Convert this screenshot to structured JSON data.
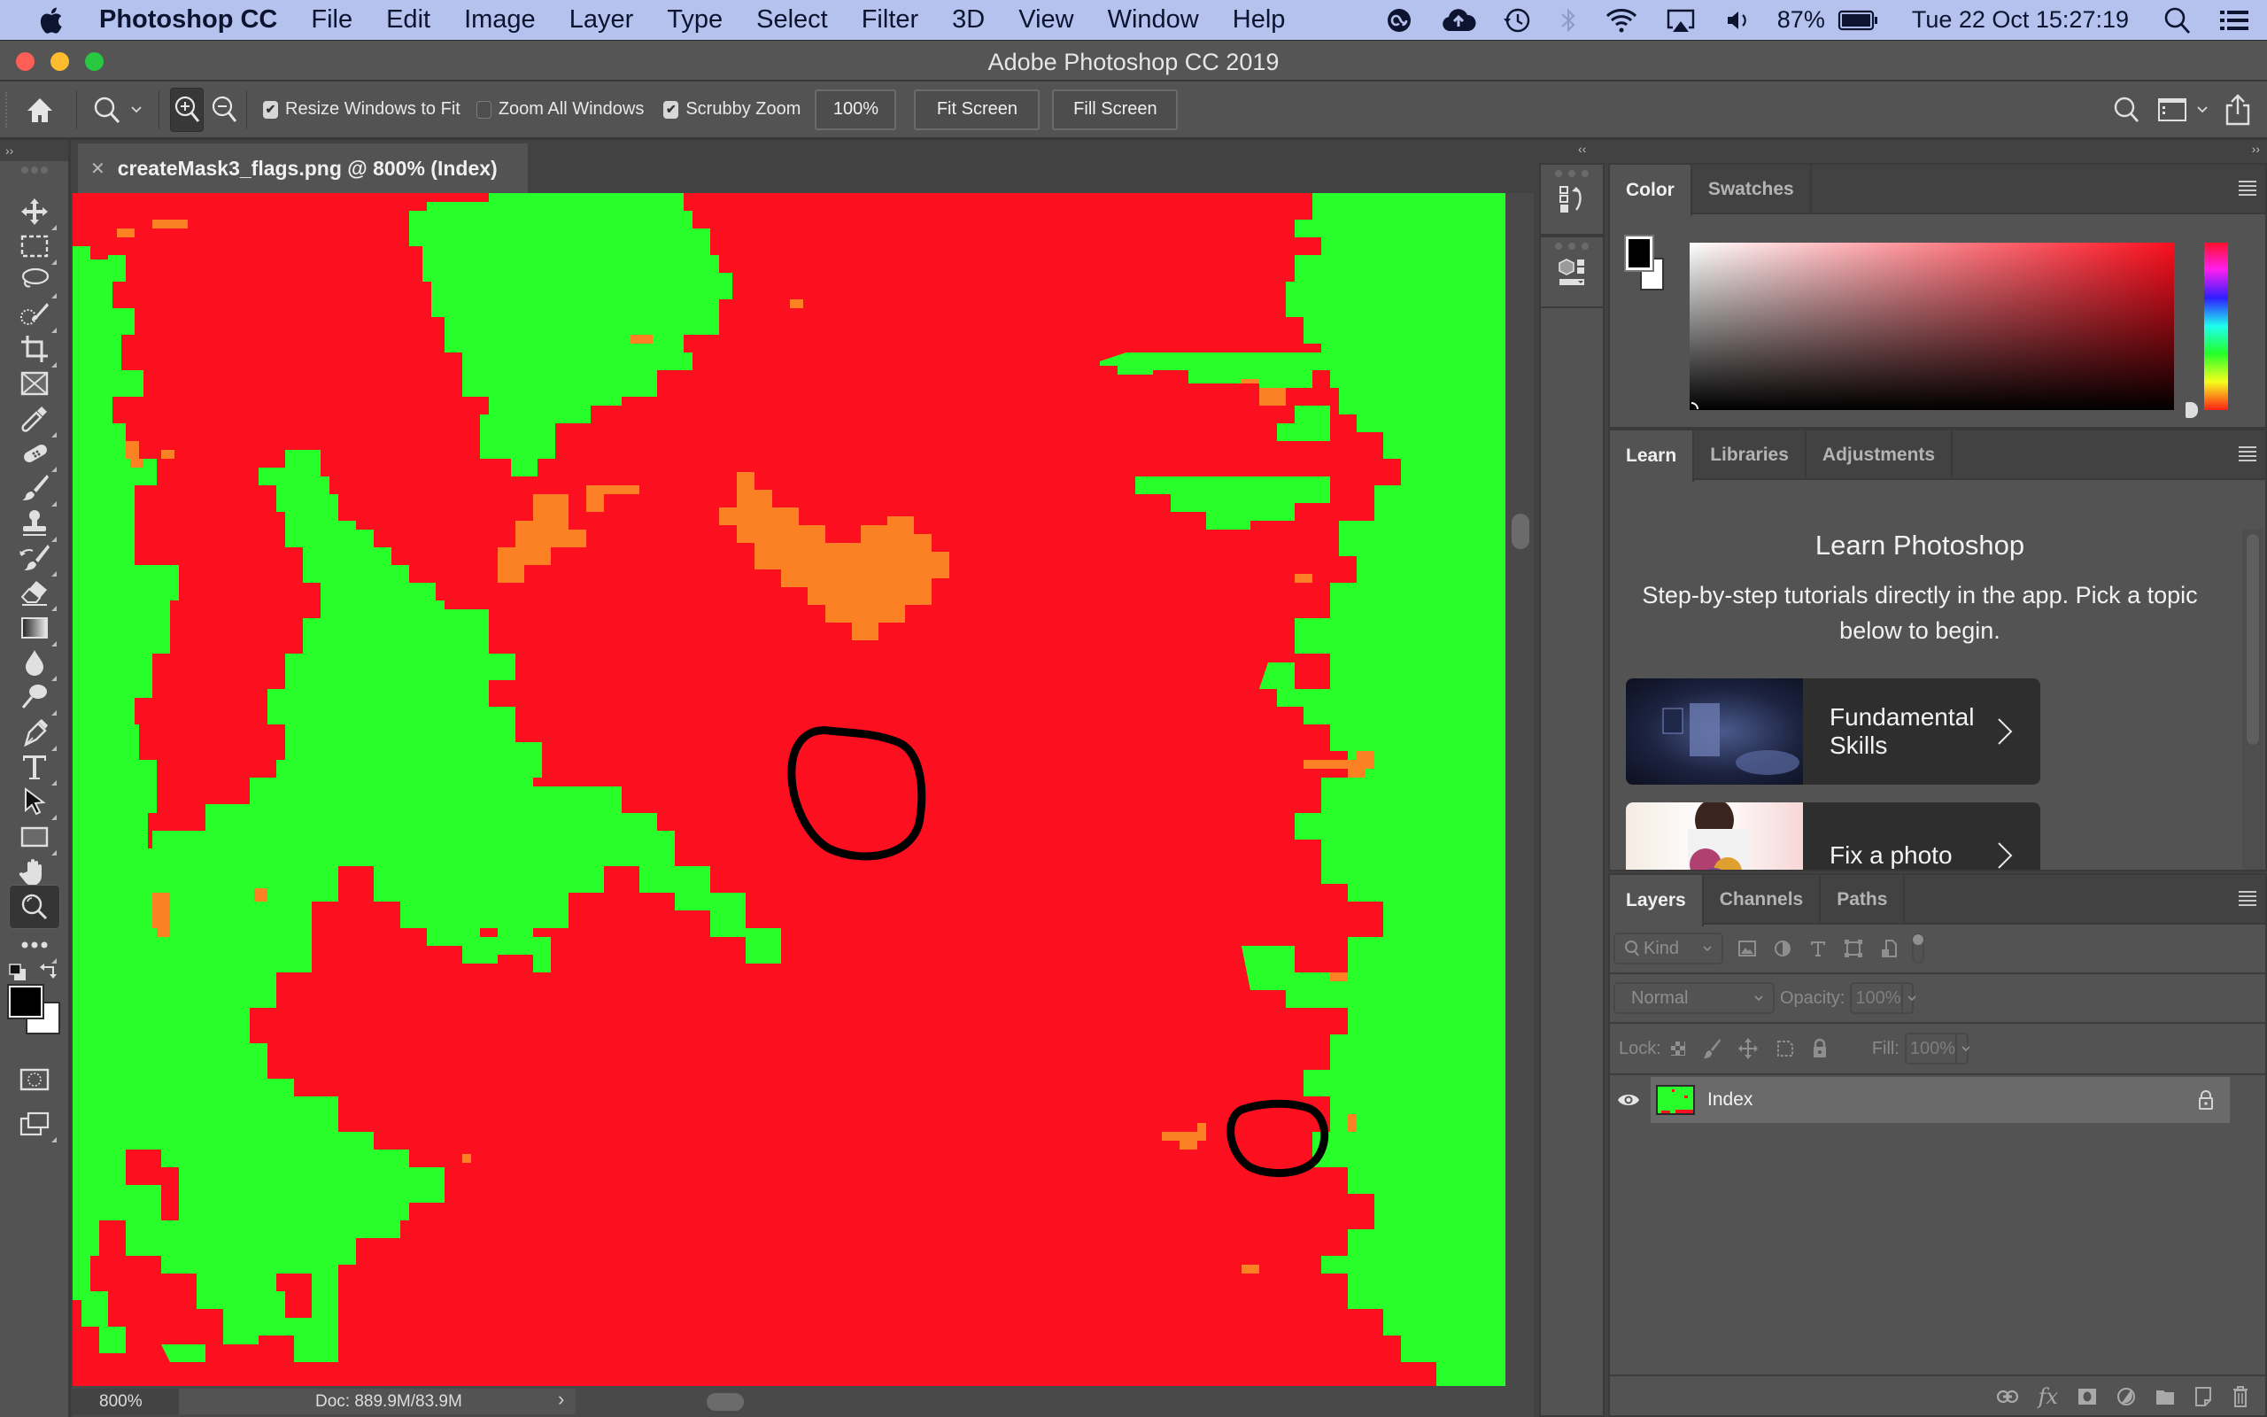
{
  "menubar": {
    "app_name": "Photoshop CC",
    "items": [
      "File",
      "Edit",
      "Image",
      "Layer",
      "Type",
      "Select",
      "Filter",
      "3D",
      "View",
      "Window",
      "Help"
    ],
    "status_icons": [
      "creative-cloud-icon",
      "cloud-upload-icon",
      "time-machine-icon",
      "bluetooth-icon",
      "wifi-icon",
      "airplay-icon",
      "volume-icon"
    ],
    "battery_percent": "87%",
    "datetime": "Tue 22 Oct  15:27:19"
  },
  "window": {
    "title": "Adobe Photoshop CC 2019"
  },
  "options_bar": {
    "resize_windows_label": "Resize Windows to Fit",
    "resize_windows_checked": true,
    "zoom_all_label": "Zoom All Windows",
    "zoom_all_checked": false,
    "scrubby_zoom_label": "Scrubby Zoom",
    "scrubby_zoom_checked": true,
    "zoom_100_label": "100%",
    "fit_screen_label": "Fit Screen",
    "fill_screen_label": "Fill Screen",
    "zoom_mode": "zoom-in"
  },
  "tools": [
    "move-tool",
    "marquee-tool",
    "lasso-tool",
    "quick-selection-tool",
    "crop-tool",
    "frame-tool",
    "eyedropper-tool",
    "healing-brush-tool",
    "brush-tool",
    "clone-stamp-tool",
    "history-brush-tool",
    "eraser-tool",
    "gradient-tool",
    "blur-tool",
    "dodge-tool",
    "pen-tool",
    "type-tool",
    "path-selection-tool",
    "rectangle-tool",
    "hand-tool",
    "zoom-tool",
    "edit-toolbar"
  ],
  "active_tool": "zoom-tool",
  "document": {
    "tab_title": "createMask3_flags.png @ 800% (Index)",
    "zoom_level": "800%",
    "doc_size": "Doc: 889.9M/83.9M",
    "image_colors": {
      "background": "#fc0f1e",
      "mask": "#27fe2a",
      "flag": "#fb8124",
      "annotation": "#000000"
    },
    "annotations": 2
  },
  "colors": {
    "foreground": "#000000",
    "background": "#ffffff"
  },
  "color_panel": {
    "tabs": [
      "Color",
      "Swatches"
    ],
    "active_tab": "Color",
    "hue_base": "#fc0f1e"
  },
  "learn_panel": {
    "tabs": [
      "Learn",
      "Libraries",
      "Adjustments"
    ],
    "active_tab": "Learn",
    "title": "Learn Photoshop",
    "subtitle": "Step-by-step tutorials directly in the app. Pick a topic below to begin.",
    "cards": [
      {
        "label": "Fundamental Skills"
      },
      {
        "label": "Fix a photo"
      }
    ]
  },
  "layers_panel": {
    "tabs": [
      "Layers",
      "Channels",
      "Paths"
    ],
    "active_tab": "Layers",
    "filter_placeholder": "Kind",
    "blend_mode": "Normal",
    "opacity_label": "Opacity:",
    "opacity_value": "100%",
    "lock_label": "Lock:",
    "fill_label": "Fill:",
    "fill_value": "100%",
    "layers": [
      {
        "name": "Index",
        "visible": true,
        "locked": true
      }
    ]
  }
}
